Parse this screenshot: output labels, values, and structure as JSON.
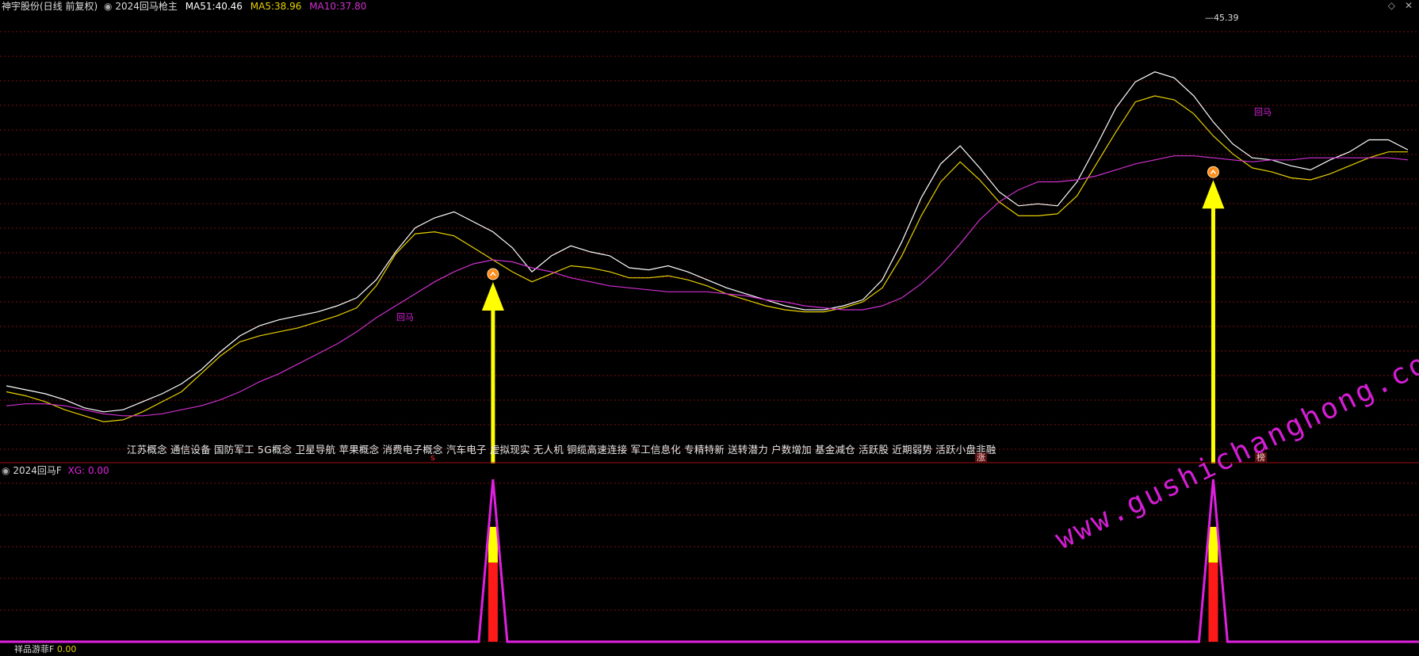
{
  "header": {
    "stock_title": "神宇股份(日线 前复权)",
    "indicator_name": "2024回马枪主",
    "ma51_label": "MA51:",
    "ma51_value": "40.46",
    "ma5_label": "MA5:",
    "ma5_value": "38.96",
    "ma10_label": "MA10:",
    "ma10_value": "37.80"
  },
  "colors": {
    "up": "#ff1a1a",
    "down": "#55f0ff",
    "ma51": "#ffffff",
    "ma5": "#e8d000",
    "ma10": "#d030d0",
    "grid": "#7a1010",
    "arrow": "#ffff00",
    "signal": "#e020e0"
  },
  "price_marks": {
    "high_label": "45.39"
  },
  "concepts_text": "江苏概念 通信设备 国防军工 5G概念 卫星导航 苹果概念 消费电子概念 汽车电子 虚拟现实 无人机 铜缆高速连接 军工信息化 专精特新 送转潜力 户数增加 基金减仓 活跃股 近期弱势 活跃小盘非融",
  "markers": {
    "huima_label": "回马",
    "s_label": "s",
    "zhang_label": "涨",
    "bang_label": "榜"
  },
  "sub_panel": {
    "indicator_name": "2024回马F",
    "xg_label": "XG: 0.00",
    "bottom_label": "祥品游菲F",
    "bottom_value": "0.00"
  },
  "watermark": "www.gushichanghong.com",
  "chart_data": {
    "type": "line",
    "series": [
      {
        "name": "MA51",
        "values": [
          27.3,
          27.1,
          26.9,
          26.6,
          26.2,
          26.0,
          26.1,
          26.5,
          26.9,
          27.4,
          28.1,
          29.0,
          29.8,
          30.3,
          30.6,
          30.8,
          31.0,
          31.3,
          31.7,
          32.6,
          34.0,
          35.2,
          35.7,
          36.0,
          35.5,
          35.0,
          34.2,
          33.0,
          33.8,
          34.3,
          34.0,
          33.8,
          33.2,
          33.1,
          33.3,
          33.0,
          32.6,
          32.2,
          31.9,
          31.6,
          31.3,
          31.1,
          31.1,
          31.3,
          31.6,
          32.6,
          34.5,
          36.7,
          38.4,
          39.3,
          38.2,
          37.0,
          36.3,
          36.4,
          36.3,
          37.5,
          39.3,
          41.2,
          42.5,
          43.0,
          42.7,
          41.8,
          40.5,
          39.4,
          38.7,
          38.6,
          38.3,
          38.1,
          38.6,
          39.0,
          39.6,
          39.6,
          39.1
        ]
      },
      {
        "name": "MA5",
        "values": [
          27.0,
          26.8,
          26.5,
          26.1,
          25.8,
          25.5,
          25.6,
          26.0,
          26.5,
          27.0,
          27.9,
          28.8,
          29.5,
          29.8,
          30.0,
          30.2,
          30.5,
          30.8,
          31.2,
          32.3,
          33.9,
          34.9,
          35.0,
          34.8,
          34.2,
          33.6,
          33.0,
          32.5,
          32.9,
          33.3,
          33.2,
          33.0,
          32.7,
          32.7,
          32.8,
          32.6,
          32.3,
          31.9,
          31.6,
          31.3,
          31.1,
          31.0,
          31.0,
          31.2,
          31.5,
          32.2,
          33.8,
          35.8,
          37.5,
          38.5,
          37.6,
          36.5,
          35.8,
          35.8,
          35.9,
          36.8,
          38.4,
          40.0,
          41.5,
          41.8,
          41.6,
          40.9,
          39.8,
          38.9,
          38.2,
          38.0,
          37.7,
          37.6,
          37.9,
          38.3,
          38.7,
          39.0,
          39.0
        ]
      },
      {
        "name": "MA10",
        "values": [
          26.3,
          26.4,
          26.4,
          26.3,
          26.1,
          25.9,
          25.8,
          25.8,
          25.9,
          26.1,
          26.3,
          26.6,
          27.0,
          27.5,
          27.9,
          28.4,
          28.9,
          29.4,
          30.0,
          30.7,
          31.3,
          31.9,
          32.5,
          33.0,
          33.4,
          33.6,
          33.5,
          33.2,
          33.0,
          32.7,
          32.5,
          32.3,
          32.2,
          32.1,
          32.0,
          32.0,
          32.0,
          31.9,
          31.8,
          31.6,
          31.5,
          31.3,
          31.2,
          31.1,
          31.1,
          31.3,
          31.7,
          32.4,
          33.3,
          34.4,
          35.6,
          36.5,
          37.1,
          37.5,
          37.5,
          37.6,
          37.8,
          38.1,
          38.4,
          38.6,
          38.8,
          38.8,
          38.7,
          38.6,
          38.5,
          38.6,
          38.6,
          38.7,
          38.7,
          38.7,
          38.7,
          38.7,
          38.6
        ]
      }
    ],
    "signal": {
      "name": "XG",
      "peak_indices": [
        25,
        62
      ]
    }
  }
}
